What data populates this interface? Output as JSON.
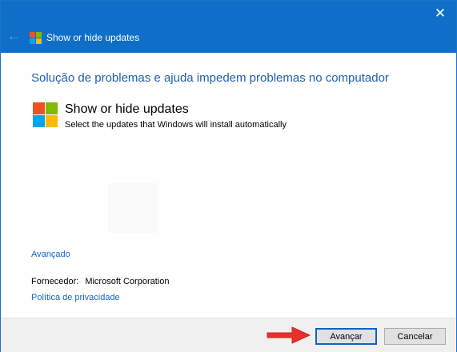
{
  "window": {
    "title": "Show or hide updates",
    "close_glyph": "✕",
    "back_glyph": "←",
    "accent": "#0f6fc8"
  },
  "main": {
    "heading": "Solução de problemas e ajuda impedem problemas no computador",
    "tool_name": "Show or hide updates",
    "tool_description": "Select the updates that Windows will install automatically",
    "advanced_link": "Avançado",
    "publisher_label": "Fornecedor:",
    "publisher_value": "Microsoft Corporation",
    "privacy_link": "Política de privacidade"
  },
  "footer": {
    "next_label": "Avançar",
    "cancel_label": "Cancelar"
  },
  "logo_colors": [
    "#f25022",
    "#7fba00",
    "#00a4ef",
    "#ffb900"
  ],
  "icons": [
    "close-icon",
    "back-arrow-icon",
    "windows-logo-icon",
    "red-arrow-icon"
  ]
}
